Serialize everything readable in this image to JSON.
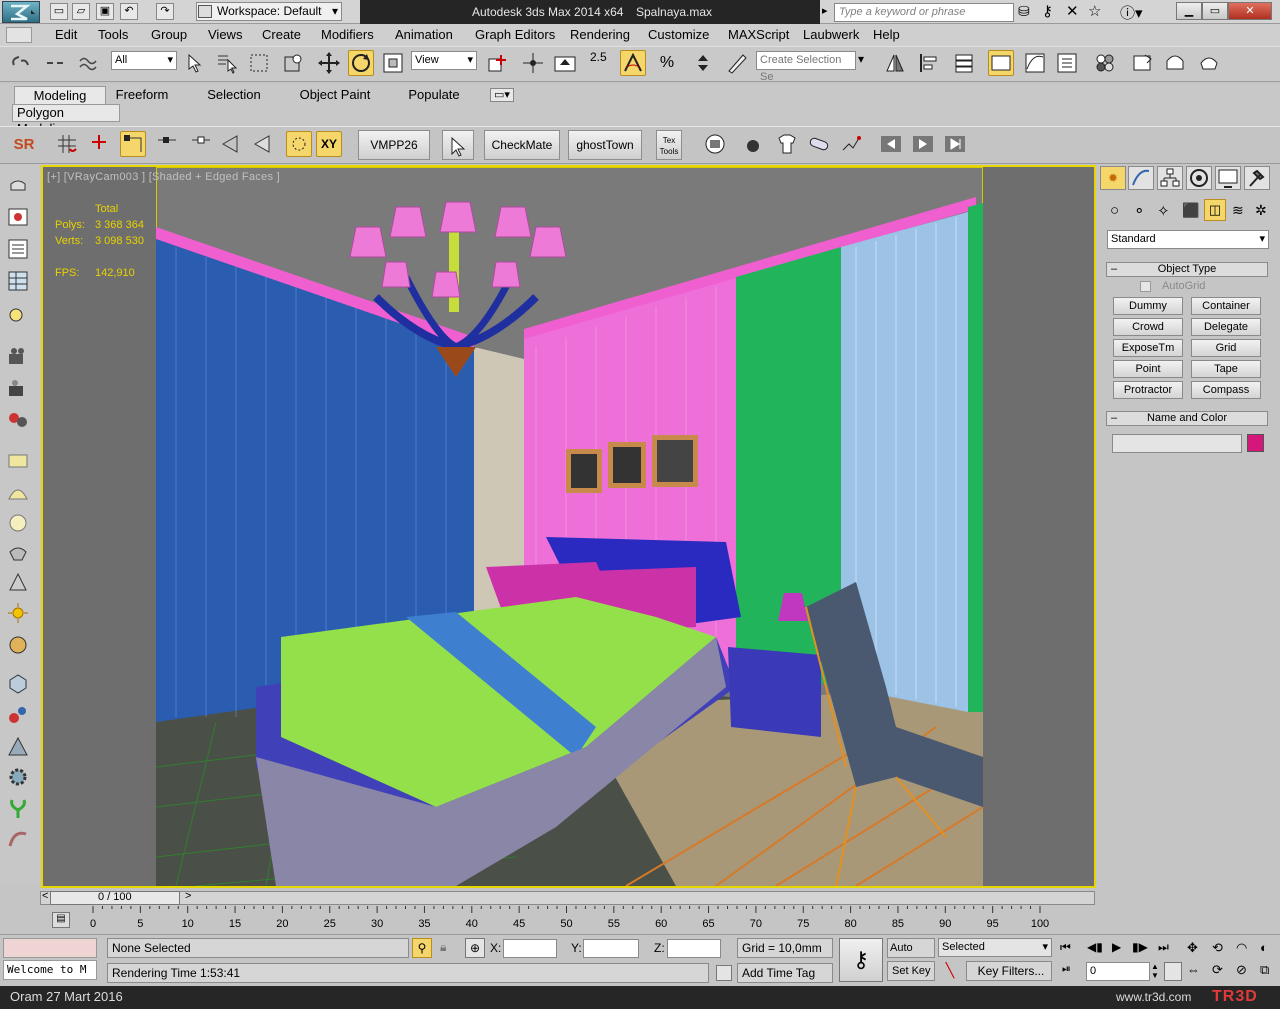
{
  "window": {
    "app_title": "Autodesk 3ds Max  2014 x64",
    "file_name": "Spalnaya.max",
    "workspace": "Workspace: Default",
    "search_placeholder": "Type a keyword or phrase"
  },
  "menu": [
    "Edit",
    "Tools",
    "Group",
    "Views",
    "Create",
    "Modifiers",
    "Animation",
    "Graph Editors",
    "Rendering",
    "Customize",
    "MAXScript",
    "Laubwerk",
    "Help"
  ],
  "toolbar": {
    "selection_filter": "All",
    "ref_coord": "View",
    "snap_value": "2.5",
    "named_selection_placeholder": "Create Selection Se"
  },
  "ribbon": {
    "tabs": [
      "Modeling",
      "Freeform",
      "Selection",
      "Object Paint",
      "Populate"
    ],
    "active_tab": "Modeling",
    "panel": "Polygon Modeling"
  },
  "toolbar2": {
    "sr": "SR",
    "xy": "XY",
    "buttons": [
      "VMPP26",
      "CheckMate",
      "ghostTown"
    ],
    "tex_tools": "Tex Tools"
  },
  "viewport": {
    "label": "[+] [VRayCam003 ] [Shaded + Edged Faces ]",
    "stats_header": "Total",
    "polys_label": "Polys:",
    "polys_value": "3 368 364",
    "verts_label": "Verts:",
    "verts_value": "3 098 530",
    "fps_label": "FPS:",
    "fps_value": "142,910"
  },
  "command_panel": {
    "category": "Standard",
    "object_type_title": "Object Type",
    "autogrid": "AutoGrid",
    "buttons": [
      "Dummy",
      "Container",
      "Crowd",
      "Delegate",
      "ExposeTm",
      "Grid",
      "Point",
      "Tape",
      "Protractor",
      "Compass"
    ],
    "name_color_title": "Name and Color",
    "color_swatch": "#d4177a"
  },
  "timeline": {
    "frame": "0 / 100",
    "ticks": [
      "0",
      "5",
      "10",
      "15",
      "20",
      "25",
      "30",
      "35",
      "40",
      "45",
      "50",
      "55",
      "60",
      "65",
      "70",
      "75",
      "80",
      "85",
      "90",
      "95",
      "100"
    ]
  },
  "status": {
    "listener": "Welcome to M",
    "selection": "None Selected",
    "render_time": "Rendering Time  1:53:41",
    "x_label": "X:",
    "y_label": "Y:",
    "z_label": "Z:",
    "grid": "Grid = 10,0mm",
    "add_time_tag": "Add Time Tag",
    "auto_key": "Auto Key",
    "set_key": "Set Key",
    "key_mode": "Selected",
    "key_filters": "Key Filters...",
    "current_frame": "0"
  },
  "footer": {
    "date": "Oram 27 Mart 2016",
    "site": "www.tr3d.com",
    "logo": "TR3D"
  }
}
